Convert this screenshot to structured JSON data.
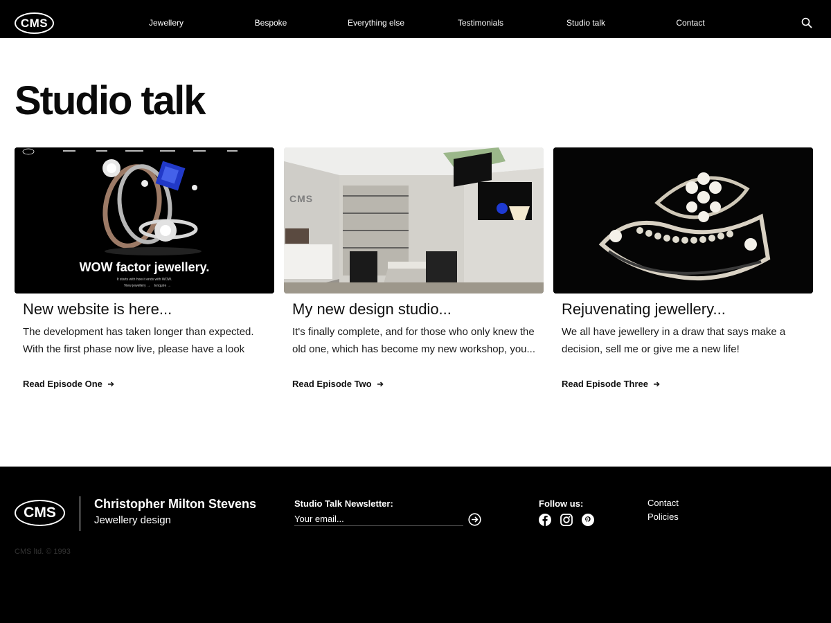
{
  "header": {
    "logo": "CMS",
    "nav": [
      {
        "label": "Jewellery"
      },
      {
        "label": "Bespoke"
      },
      {
        "label": "Everything else"
      },
      {
        "label": "Testimonials"
      },
      {
        "label": "Studio talk"
      },
      {
        "label": "Contact"
      }
    ],
    "search_icon": "search-icon"
  },
  "page": {
    "title": "Studio talk"
  },
  "cards": [
    {
      "image_caption": "WOW factor jewellery.",
      "image_subcaption": "It starts with how it ends with WOW.",
      "image_links": [
        "View jewellery →",
        "Enquire →"
      ],
      "title": "New website is here...",
      "excerpt": "The development has taken longer than expected. With the first phase now live, please have a look an...",
      "link": "Read Episode One"
    },
    {
      "image_sign": "CMS",
      "title": "My new design studio...",
      "excerpt": "It's finally complete, and for those who only knew the old one, which has become my new workshop, you...",
      "link": "Read Episode Two"
    },
    {
      "title": "Rejuvenating jewellery...",
      "excerpt": "We all have jewellery in a draw that says make a decision, sell me or give me a new life!",
      "link": "Read Episode Three"
    }
  ],
  "footer": {
    "logo": "CMS",
    "brand_name": "Christopher Milton Stevens",
    "brand_sub": "Jewellery design",
    "newsletter_label": "Studio Talk Newsletter:",
    "email_placeholder": "Your email...",
    "follow_label": "Follow us:",
    "social_icons": [
      "facebook-icon",
      "instagram-icon",
      "pinterest-icon"
    ],
    "links": [
      "Contact",
      "Policies"
    ],
    "copyright": "CMS ltd. © 1993"
  }
}
